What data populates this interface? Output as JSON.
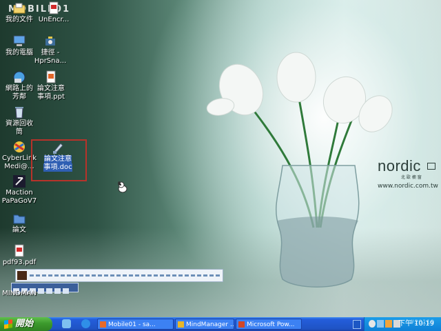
{
  "watermark": "MOBILE01",
  "icons": [
    {
      "label": "我的文件"
    },
    {
      "label": "UnEncr..."
    },
    {
      "label": "我的電腦"
    },
    {
      "label": "捷徑 -",
      "label2": "HprSna..."
    },
    {
      "label": "網路上的",
      "label2": "芳鄰"
    },
    {
      "label": "論文注意",
      "label2": "事項.ppt"
    },
    {
      "label": "資源回收",
      "label2": "筒"
    },
    {
      "label": "CyberLink",
      "label2": "Medi@..."
    },
    {
      "label": "論文注意",
      "label2": "事項.doc"
    },
    {
      "label": "Maction",
      "label2": "PaPaGoV7"
    },
    {
      "label": "論文"
    },
    {
      "label": "pdf93.pdf"
    },
    {
      "label": "MINDMAN"
    }
  ],
  "brand": {
    "name": "nordic",
    "subtitle": "北 歐 櫥 窗",
    "url": "www.nordic.com.tw"
  },
  "taskbar": {
    "start_label": "開始",
    "tasks": [
      "Mobile01 - sa...",
      "MindManager ...",
      "Microsoft Pow..."
    ],
    "clock": "下午 10:19",
    "tray_watermark": "#20119"
  },
  "colors": {
    "selection": "#2f5fb3",
    "highlight_box": "#b8322a",
    "taskbar": "#245edb",
    "start": "#3c9a2d"
  }
}
